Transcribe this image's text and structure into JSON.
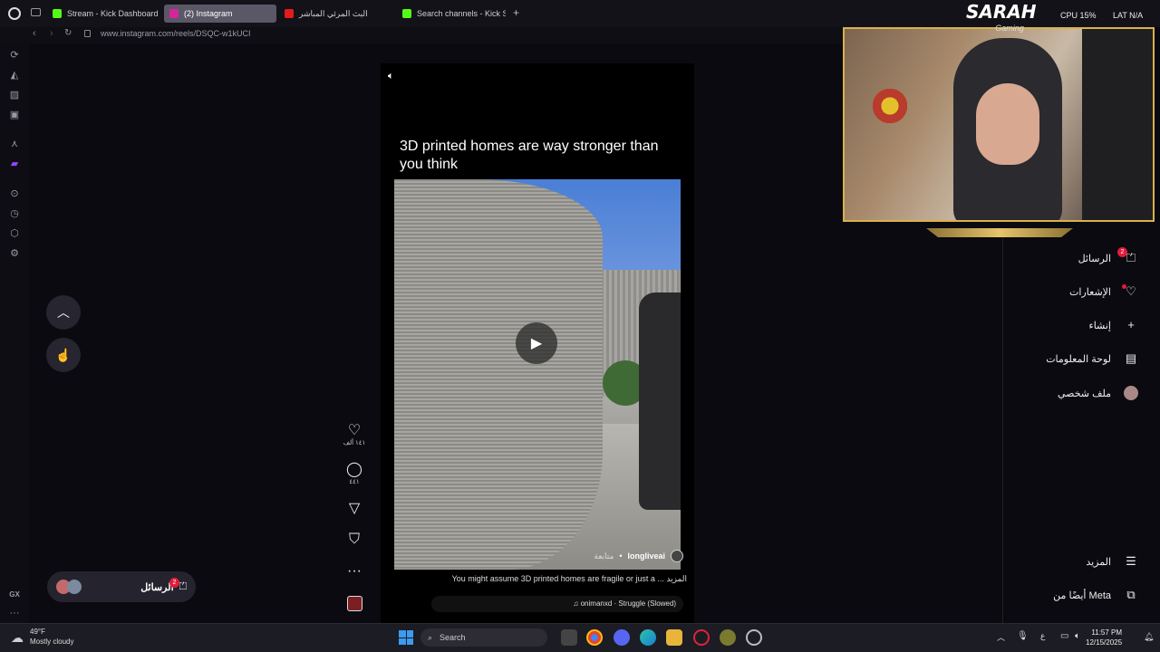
{
  "tabs": [
    {
      "label": "Stream - Kick Dashboard",
      "color": "#53fc18"
    },
    {
      "label": "(2) Instagram",
      "color": "#d6249f"
    },
    {
      "label": "البث المرئي المباشر",
      "color": "#e21c1c"
    },
    {
      "label": "Search channels - Kick St",
      "color": "#53fc18"
    }
  ],
  "new_tab": "+",
  "address": {
    "url": "www.instagram.com/reels/DSQC-w1kUCI"
  },
  "overlay": {
    "brand": "SARAH",
    "brand_sub": "Gaming",
    "cpu": "CPU 15%",
    "lat": "LAT N/A"
  },
  "reel": {
    "title": "3D printed homes are way stronger than you think",
    "username": "longliveai",
    "follow": "متابعة",
    "caption": "You might assume 3D printed homes are fragile or just a ... المزيد",
    "audio": "onimanxd · Struggle (Slowed)",
    "likes": "١٤١ ألف",
    "comments": "٤٤١"
  },
  "right_nav": {
    "messages": "الرسائل",
    "messages_badge": "2",
    "notifications": "الإشعارات",
    "create": "إنشاء",
    "dashboard": "لوحة المعلومات",
    "profile": "ملف شخصي",
    "more": "المزيد",
    "meta": "أيضًا من Meta"
  },
  "messages_pill": {
    "label": "الرسائل",
    "badge": "2"
  },
  "sidebar_bottom": {
    "gx": "GX",
    "dots": "···"
  },
  "taskbar": {
    "temp": "49°F",
    "weather": "Mostly cloudy",
    "search": "Search",
    "time": "11:57 PM",
    "date": "12/15/2025",
    "lang": "ع"
  },
  "colors": {
    "accent": "#d9b24a",
    "badge": "#e21c3a",
    "bg": "#0b0a10"
  }
}
